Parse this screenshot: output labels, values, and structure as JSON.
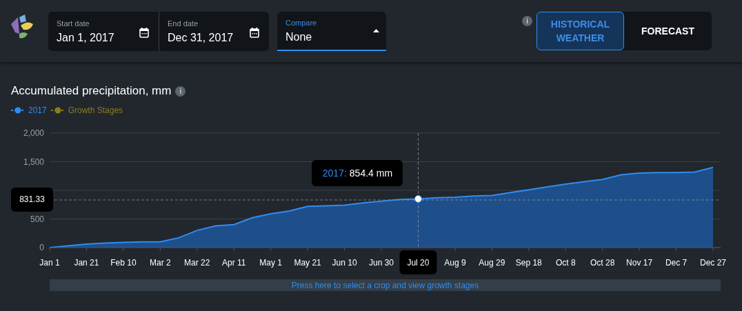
{
  "header": {
    "date_fields": [
      {
        "label": "Start date",
        "value": "Jan 1, 2017"
      },
      {
        "label": "End date",
        "value": "Dec 31, 2017"
      }
    ],
    "compare": {
      "label": "Compare",
      "value": "None"
    },
    "info_icon": "i",
    "mode_tabs": [
      {
        "label": "HISTORICAL WEATHER",
        "selected": true
      },
      {
        "label": "FORECAST",
        "selected": false
      }
    ]
  },
  "chart": {
    "title": "Accumulated precipitation, mm",
    "info_icon": "i",
    "extra_legend": [
      {
        "label": "Growth Stages",
        "color": "#8a7d1e"
      }
    ],
    "chart_data": {
      "type": "area",
      "ylim": [
        0,
        2000
      ],
      "yticks": [
        {
          "value": 0,
          "label": "0"
        },
        {
          "value": 500,
          "label": "500"
        },
        {
          "value": 1500,
          "label": "1,500"
        },
        {
          "value": 2000,
          "label": "2,000"
        }
      ],
      "categories": [
        "Jan 1",
        null,
        "Jan 21",
        null,
        "Feb 10",
        null,
        "Mar 2",
        null,
        "Mar 22",
        null,
        "Apr 11",
        null,
        "May 1",
        null,
        "May 21",
        null,
        "Jun 10",
        null,
        "Jun 30",
        null,
        "Jul 20",
        null,
        "Aug 9",
        null,
        "Aug 29",
        null,
        "Sep 18",
        null,
        "Oct 8",
        null,
        "Oct 28",
        null,
        "Nov 17",
        null,
        "Dec 7",
        null,
        "Dec 27"
      ],
      "series": [
        {
          "name": "2017",
          "color": "#2f8df2",
          "values": [
            0,
            30,
            60,
            80,
            90,
            100,
            100,
            170,
            300,
            380,
            400,
            520,
            590,
            640,
            720,
            730,
            740,
            780,
            810,
            840,
            850,
            870,
            880,
            900,
            910,
            960,
            1010,
            1060,
            1110,
            1150,
            1190,
            1270,
            1300,
            1310,
            1310,
            1320,
            1400
          ]
        }
      ],
      "ref_lines": [
        {
          "axis": "y",
          "value": 831.33,
          "label": "831.33"
        },
        {
          "axis": "x",
          "value": "Jul 20"
        }
      ]
    },
    "crosshair": {
      "tooltip_series": "2017:",
      "tooltip_value": "854.4 mm"
    },
    "banner": "Press here to select a crop and view growth stages"
  }
}
